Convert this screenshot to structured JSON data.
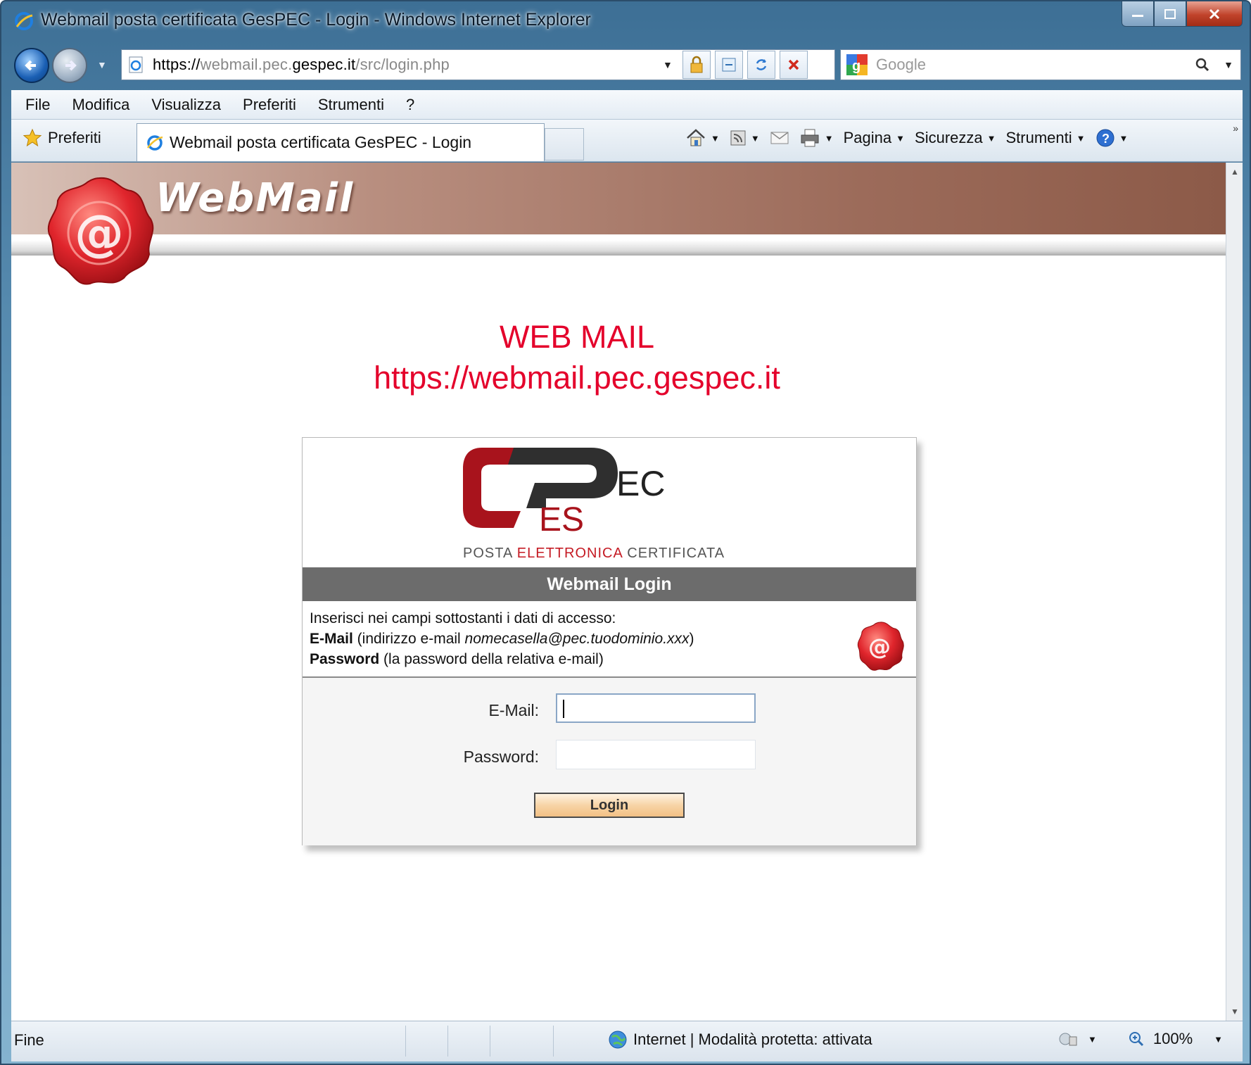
{
  "window": {
    "title": "Webmail posta certificata GesPEC - Login - Windows Internet Explorer"
  },
  "address_bar": {
    "url_scheme": "https://",
    "url_sub": "webmail.pec.",
    "url_domain": "gespec.it",
    "url_path": "/src/login.php"
  },
  "search": {
    "placeholder": "Google"
  },
  "menu": {
    "items": [
      "File",
      "Modifica",
      "Visualizza",
      "Preferiti",
      "Strumenti",
      "?"
    ]
  },
  "favorites": {
    "label": "Preferiti",
    "tab_title": "Webmail posta certificata GesPEC - Login"
  },
  "command_bar": {
    "pagina": "Pagina",
    "sicurezza": "Sicurezza",
    "strumenti": "Strumenti"
  },
  "page": {
    "header_title": "WebMail",
    "heading_line1": "WEB MAIL",
    "heading_line2": "https://webmail.pec.gespec.it",
    "logo_main": "EC",
    "logo_sub": "ES",
    "logo_tagline_a": "POSTA ",
    "logo_tagline_b": "ELETTRONICA",
    "logo_tagline_c": " CERTIFICATA",
    "login_header": "Webmail Login",
    "instructions_line1": "Inserisci nei campi sottostanti i dati di accesso:",
    "instructions_email_bold": "E-Mail",
    "instructions_email_rest_a": " (indirizzo e-mail ",
    "instructions_email_example": "nomecasella@pec.tuodominio.xxx",
    "instructions_email_rest_b": ")",
    "instructions_password_bold": "Password",
    "instructions_password_rest": " (la password della relativa e-mail)",
    "email_label": "E-Mail:",
    "email_value": "",
    "password_label": "Password:",
    "password_value": "",
    "login_button": "Login"
  },
  "status_bar": {
    "status": "Fine",
    "zone": "Internet | Modalità protetta: attivata",
    "zoom": "100%"
  },
  "colors": {
    "accent_red": "#e4002b",
    "header_brown": "#9c6b5a",
    "login_header_gray": "#6c6c6c",
    "button_orange": "#f7d4a6"
  }
}
